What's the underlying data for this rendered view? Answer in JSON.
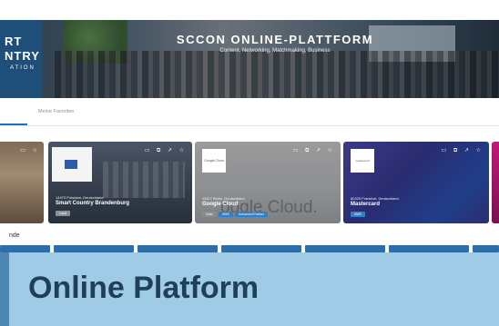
{
  "hero": {
    "logo_line1": "RT",
    "logo_line2": "NTRY",
    "logo_line3": "ATION",
    "title": "SCCON ONLINE-PLATTFORM",
    "subtitle": "Content, Networking, Matchmaking, Business"
  },
  "tabs": {
    "favorites_label": "Meine Favoriten"
  },
  "cards": [
    {
      "location": "14473 Potsdam, Deutschland",
      "name": "Smart Country Brandenburg",
      "tags": [
        "Land"
      ]
    },
    {
      "logo_text": "Google Cloud",
      "bg_text": "oogle Cloud.",
      "location": "10117 Berlin, Deutschland",
      "name": "Google Cloud",
      "tags": [
        "Gold",
        "AWS",
        "Advanced Partner"
      ]
    },
    {
      "logo_text": "mastercard",
      "location": "60325 Frankfurt, Deutschland",
      "name": "Mastercard",
      "tags": [
        "AWS"
      ]
    }
  ],
  "section": {
    "label": "nde"
  },
  "banner": {
    "title": "Online Platform"
  },
  "colors": {
    "accent": "#1f6fb2",
    "banner_bg": "#9fcbe6",
    "banner_text": "#203f5c"
  }
}
